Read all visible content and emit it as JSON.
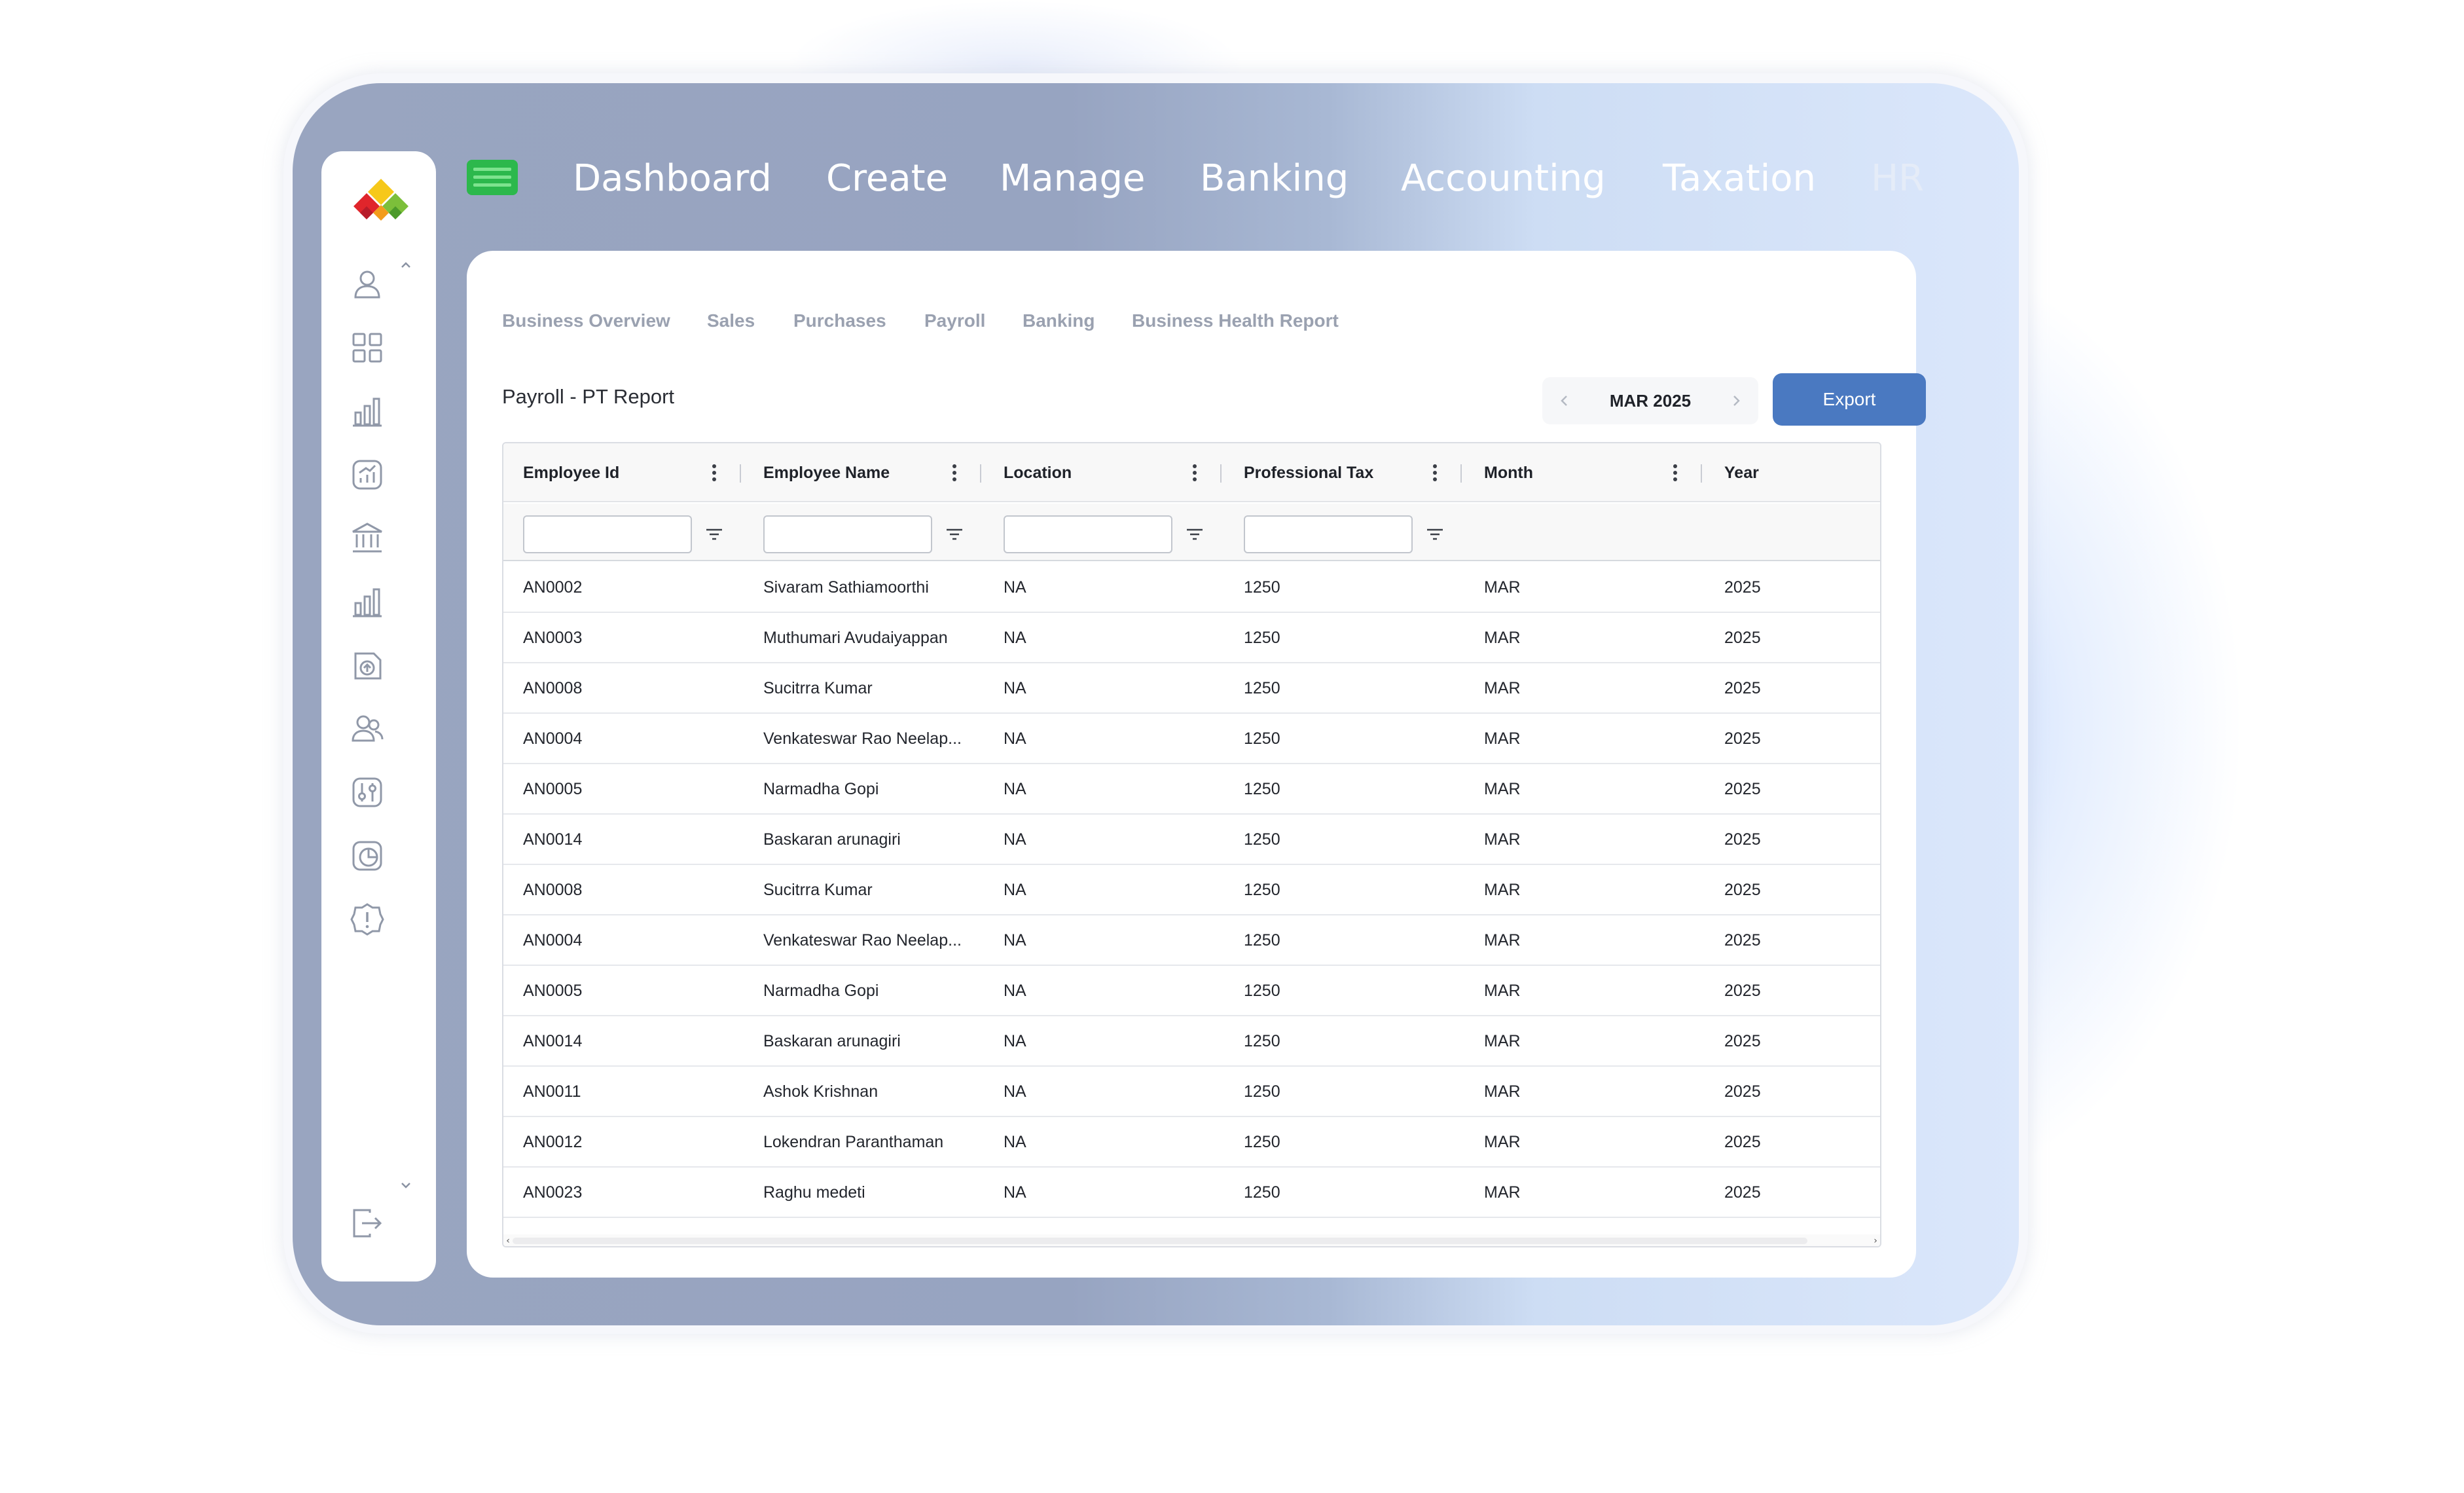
{
  "top_nav": {
    "items": [
      "Dashboard",
      "Create",
      "Manage",
      "Banking",
      "Accounting",
      "Taxation",
      "HR"
    ]
  },
  "sidebar": {
    "icons": [
      "user-icon",
      "grid-icon",
      "bar-chart-icon",
      "analytics-icon",
      "bank-icon",
      "reports-icon",
      "upload-icon",
      "users-icon",
      "settings-sliders-icon",
      "pie-chart-icon",
      "alert-icon"
    ],
    "logout_icon": "logout-icon"
  },
  "subtabs": [
    "Business Overview",
    "Sales",
    "Purchases",
    "Payroll",
    "Banking",
    "Business Health Report"
  ],
  "report": {
    "title": "Payroll - PT Report",
    "period": "MAR 2025",
    "export_label": "Export"
  },
  "table": {
    "columns": [
      "Employee Id",
      "Employee Name",
      "Location",
      "Professional Tax",
      "Month",
      "Year"
    ],
    "rows": [
      [
        "AN0002",
        "Sivaram Sathiamoorthi",
        "NA",
        "1250",
        "MAR",
        "2025"
      ],
      [
        "AN0003",
        "Muthumari Avudaiyappan",
        "NA",
        "1250",
        "MAR",
        "2025"
      ],
      [
        "AN0008",
        "Sucitrra Kumar",
        "NA",
        "1250",
        "MAR",
        "2025"
      ],
      [
        "AN0004",
        "Venkateswar Rao Neelap...",
        "NA",
        "1250",
        "MAR",
        "2025"
      ],
      [
        "AN0005",
        "Narmadha Gopi",
        "NA",
        "1250",
        "MAR",
        "2025"
      ],
      [
        "AN0014",
        "Baskaran arunagiri",
        "NA",
        "1250",
        "MAR",
        "2025"
      ],
      [
        "AN0008",
        "Sucitrra Kumar",
        "NA",
        "1250",
        "MAR",
        "2025"
      ],
      [
        "AN0004",
        "Venkateswar Rao Neelap...",
        "NA",
        "1250",
        "MAR",
        "2025"
      ],
      [
        "AN0005",
        "Narmadha Gopi",
        "NA",
        "1250",
        "MAR",
        "2025"
      ],
      [
        "AN0014",
        "Baskaran arunagiri",
        "NA",
        "1250",
        "MAR",
        "2025"
      ],
      [
        "AN0011",
        "Ashok Krishnan",
        "NA",
        "1250",
        "MAR",
        "2025"
      ],
      [
        "AN0012",
        "Lokendran Paranthaman",
        "NA",
        "1250",
        "MAR",
        "2025"
      ],
      [
        "AN0023",
        "Raghu  medeti",
        "NA",
        "1250",
        "MAR",
        "2025"
      ]
    ]
  },
  "colors": {
    "accent": "#4a79c1",
    "menu_button": "#2cb84c",
    "logo_red": "#e0252b",
    "logo_orange": "#f39c1b",
    "logo_yellow": "#f6c81a",
    "logo_green": "#7cbf3a"
  }
}
